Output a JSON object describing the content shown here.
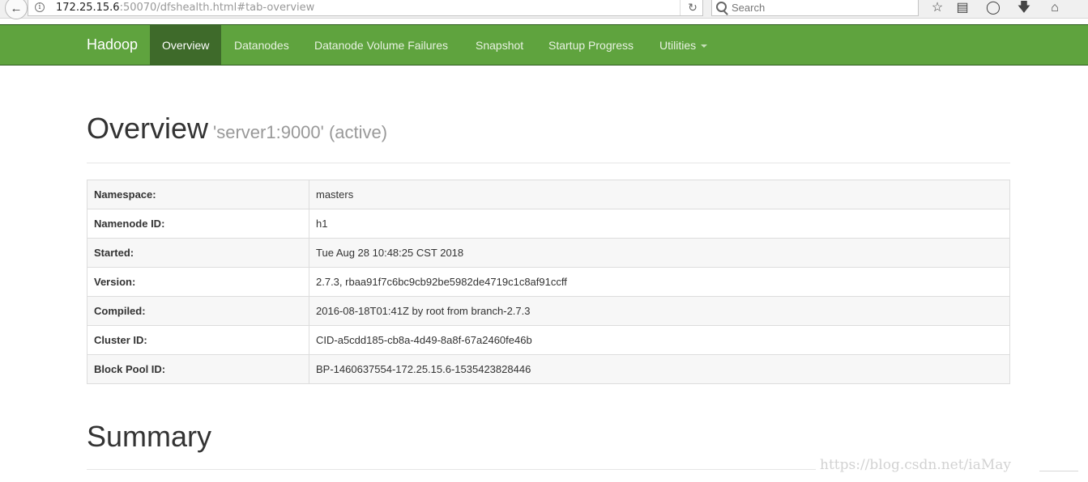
{
  "browser": {
    "url_host": "172.25.15.6",
    "url_rest": ":50070/dfshealth.html#tab-overview",
    "search_placeholder": "Search"
  },
  "navbar": {
    "brand": "Hadoop",
    "items": [
      {
        "label": "Overview",
        "active": true
      },
      {
        "label": "Datanodes"
      },
      {
        "label": "Datanode Volume Failures"
      },
      {
        "label": "Snapshot"
      },
      {
        "label": "Startup Progress"
      },
      {
        "label": "Utilities"
      }
    ]
  },
  "overview": {
    "title": "Overview",
    "subtitle": "'server1:9000' (active)",
    "rows": [
      {
        "key": "Namespace:",
        "value": "masters"
      },
      {
        "key": "Namenode ID:",
        "value": "h1"
      },
      {
        "key": "Started:",
        "value": "Tue Aug 28 10:48:25 CST 2018"
      },
      {
        "key": "Version:",
        "value": "2.7.3, rbaa91f7c6bc9cb92be5982de4719c1c8af91ccff"
      },
      {
        "key": "Compiled:",
        "value": "2016-08-18T01:41Z by root from branch-2.7.3"
      },
      {
        "key": "Cluster ID:",
        "value": "CID-a5cdd185-cb8a-4d49-8a8f-67a2460fe46b"
      },
      {
        "key": "Block Pool ID:",
        "value": "BP-1460637554-172.25.15.6-1535423828446"
      }
    ]
  },
  "summary": {
    "title": "Summary"
  },
  "watermark": "https://blog.csdn.net/iaMay"
}
